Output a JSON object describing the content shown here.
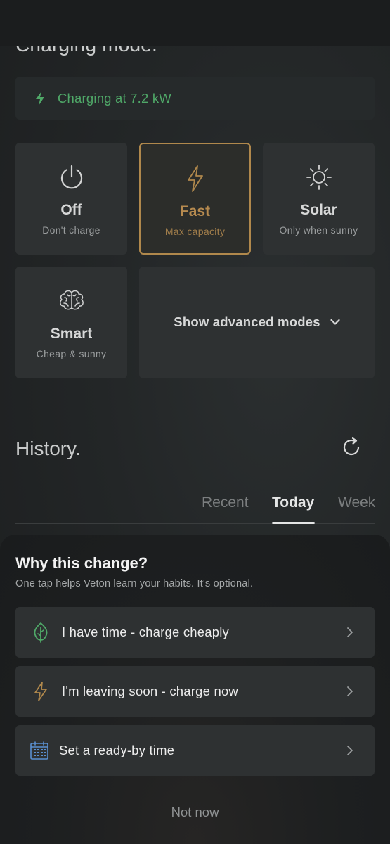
{
  "header": {
    "section_title": "Charging mode."
  },
  "status": {
    "text": "Charging at 7.2 kW",
    "icon": "bolt-icon",
    "color": "#4fa868"
  },
  "modes": [
    {
      "name": "Off",
      "sub": "Don't charge",
      "icon": "power-icon",
      "selected": false
    },
    {
      "name": "Fast",
      "sub": "Max capacity",
      "icon": "bolt-icon",
      "selected": true
    },
    {
      "name": "Solar",
      "sub": "Only when sunny",
      "icon": "sun-icon",
      "selected": false
    },
    {
      "name": "Smart",
      "sub": "Cheap & sunny",
      "icon": "brain-icon",
      "selected": false
    }
  ],
  "advanced": {
    "label": "Show advanced modes",
    "icon": "chevron-down-icon"
  },
  "history": {
    "title": "History.",
    "tabs": [
      {
        "label": "Recent",
        "active": false
      },
      {
        "label": "Today",
        "active": true
      },
      {
        "label": "Week",
        "active": false
      }
    ]
  },
  "sheet": {
    "title": "Why this change?",
    "subtitle": "One tap helps Veton learn your habits. It's optional.",
    "options": [
      {
        "label": "I have time - charge cheaply",
        "icon": "leaf-icon"
      },
      {
        "label": "I'm leaving soon - charge now",
        "icon": "bolt-icon"
      },
      {
        "label": "Set a ready-by time",
        "icon": "calendar-icon"
      }
    ],
    "dismiss": "Not now"
  },
  "colors": {
    "accent": "#b0884c",
    "green": "#4fa868",
    "calendar_blue": "#5a8fd0"
  }
}
